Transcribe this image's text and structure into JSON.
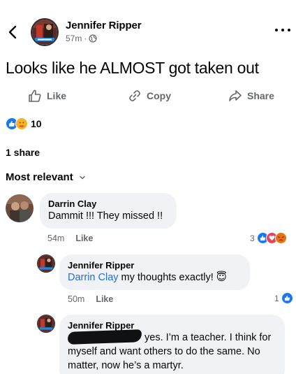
{
  "header": {
    "back_icon": "chevron-left-icon",
    "author": "Jennifer Ripper",
    "time": "57m",
    "separator": "·",
    "privacy_icon": "globe-icon",
    "more_icon": "more-horizontal-icon"
  },
  "post": {
    "text": "Looks like he ALMOST got taken out"
  },
  "actions": {
    "like": "Like",
    "copy": "Copy",
    "share": "Share"
  },
  "reactions": {
    "icons": [
      "like-reaction-icon",
      "care-reaction-icon"
    ],
    "count": "10"
  },
  "shares": "1 share",
  "sort": {
    "label": "Most relevant",
    "icon": "chevron-down-icon"
  },
  "comments": [
    {
      "author": "Darrin Clay",
      "text": "Dammit !!! They missed !!",
      "time": "54m",
      "like_label": "Like",
      "reaction_count": "3",
      "reaction_icons": [
        "like-reaction-icon",
        "love-reaction-icon",
        "angry-reaction-icon"
      ]
    },
    {
      "author": "Jennifer Ripper",
      "mention": "Darrin Clay",
      "text": "my thoughts exactly!",
      "emoji": "😇",
      "time": "50m",
      "like_label": "Like",
      "reaction_count": "1",
      "reaction_icons": [
        "like-reaction-icon"
      ]
    },
    {
      "author": "Jennifer Ripper",
      "text_line1": "yes. I’m a teacher. I think for",
      "text_line2": "myself and want others to do the same. No",
      "text_line3": "matter, now he’s a martyr."
    }
  ],
  "colors": {
    "accent_blue": "#1877f2",
    "mention_blue": "#216fdb",
    "secondary_text": "#65676b",
    "bubble_bg": "#f0f2f5",
    "love_red": "#f33e58",
    "angry_orange": "#e9710f"
  }
}
